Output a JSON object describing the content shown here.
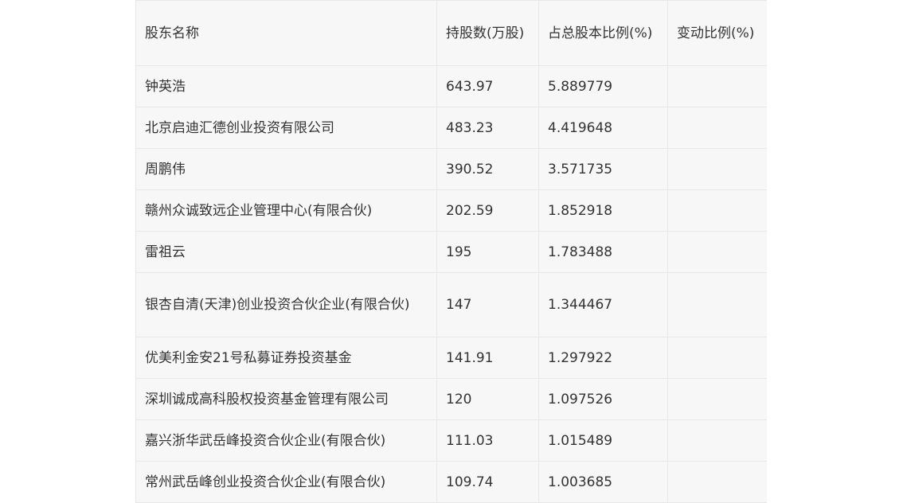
{
  "table": {
    "headers": [
      "股东名称",
      "持股数(万股)",
      "占总股本比例(%)",
      "变动比例(%)"
    ],
    "rows": [
      {
        "name": "钟英浩",
        "shares": "643.97",
        "ratio": "5.889779",
        "change": ""
      },
      {
        "name": "北京启迪汇德创业投资有限公司",
        "shares": "483.23",
        "ratio": "4.419648",
        "change": ""
      },
      {
        "name": "周鹏伟",
        "shares": "390.52",
        "ratio": "3.571735",
        "change": ""
      },
      {
        "name": "赣州众诚致远企业管理中心(有限合伙)",
        "shares": "202.59",
        "ratio": "1.852918",
        "change": ""
      },
      {
        "name": "雷祖云",
        "shares": "195",
        "ratio": "1.783488",
        "change": ""
      },
      {
        "name": "银杏自清(天津)创业投资合伙企业(有限合伙)",
        "shares": "147",
        "ratio": "1.344467",
        "change": ""
      },
      {
        "name": "优美利金安21号私募证券投资基金",
        "shares": "141.91",
        "ratio": "1.297922",
        "change": ""
      },
      {
        "name": "深圳诚成高科股权投资基金管理有限公司",
        "shares": "120",
        "ratio": "1.097526",
        "change": ""
      },
      {
        "name": "嘉兴浙华武岳峰投资合伙企业(有限合伙)",
        "shares": "111.03",
        "ratio": "1.015489",
        "change": ""
      },
      {
        "name": "常州武岳峰创业投资合伙企业(有限合伙)",
        "shares": "109.74",
        "ratio": "1.003685",
        "change": ""
      }
    ]
  }
}
